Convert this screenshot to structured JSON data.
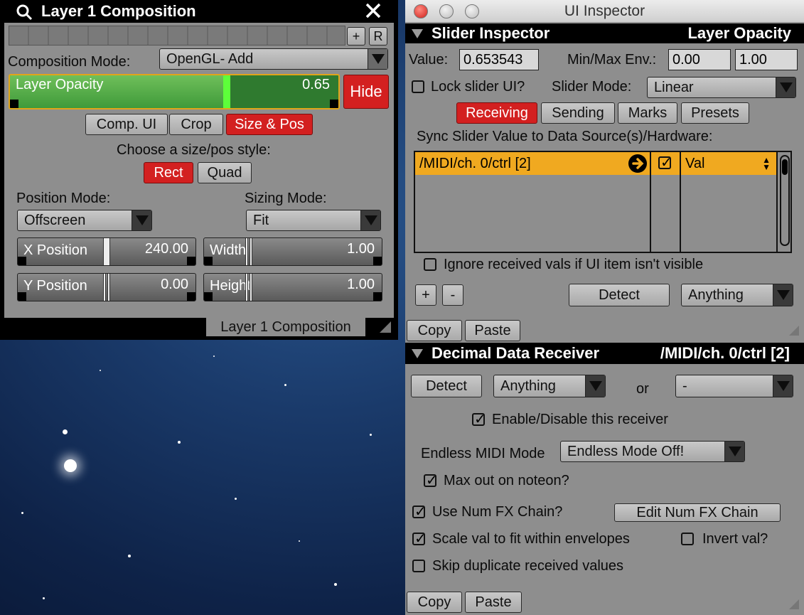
{
  "composition_window": {
    "title": "Layer 1 Composition",
    "plus_label": "+",
    "r_label": "R",
    "composition_mode_label": "Composition Mode:",
    "composition_mode_value": "OpenGL- Add",
    "opacity_slider": {
      "label": "Layer Opacity",
      "value_text": "0.65",
      "fraction": 0.65
    },
    "hide_label": "Hide",
    "tabs": [
      "Comp. UI",
      "Crop",
      "Size & Pos"
    ],
    "size_pos_prompt": "Choose a size/pos style:",
    "style_buttons": [
      "Rect",
      "Quad"
    ],
    "position_mode_label": "Position Mode:",
    "position_mode_value": "Offscreen",
    "sizing_mode_label": "Sizing Mode:",
    "sizing_mode_value": "Fit",
    "x_position": {
      "label": "X Position",
      "value": "240.00"
    },
    "width": {
      "label": "Width",
      "value": "1.00"
    },
    "y_position": {
      "label": "Y Position",
      "value": "0.00"
    },
    "height": {
      "label": "Height",
      "value": "1.00"
    },
    "footer_tab": "Layer 1 Composition"
  },
  "inspector_window": {
    "title": "UI Inspector",
    "slider_inspector": {
      "header": "Slider Inspector",
      "header_right": "Layer Opacity",
      "value_label": "Value:",
      "value": "0.653543",
      "minmax_label": "Min/Max Env.:",
      "min": "0.00",
      "max": "1.00",
      "lock_label": "Lock slider UI?",
      "slider_mode_label": "Slider Mode:",
      "slider_mode_value": "Linear",
      "tabs": [
        "Receiving",
        "Sending",
        "Marks",
        "Presets"
      ],
      "sync_label": "Sync Slider Value to Data Source(s)/Hardware:",
      "source_row": {
        "path": "/MIDI/ch. 0/ctrl [2]",
        "mode": "Val"
      },
      "ignore_label": "Ignore received vals if UI item isn't visible",
      "plus_label": "+",
      "minus_label": "-",
      "detect_label": "Detect",
      "anything_value": "Anything",
      "copy_label": "Copy",
      "paste_label": "Paste"
    },
    "decimal_receiver": {
      "header": "Decimal Data Receiver",
      "header_right": "/MIDI/ch. 0/ctrl [2]",
      "detect_label": "Detect",
      "anything_value": "Anything",
      "or_label": "or",
      "second_value": "-",
      "enable_label": "Enable/Disable this receiver",
      "endless_label": "Endless MIDI Mode",
      "endless_value": "Endless Mode Off!",
      "max_noteon_label": "Max out on noteon?",
      "num_fx_label": "Use Num FX Chain?",
      "edit_fx_label": "Edit Num FX Chain",
      "scale_label": "Scale val to fit within envelopes",
      "invert_label": "Invert val?",
      "skip_label": "Skip duplicate received values",
      "copy_label": "Copy",
      "paste_label": "Paste"
    }
  }
}
